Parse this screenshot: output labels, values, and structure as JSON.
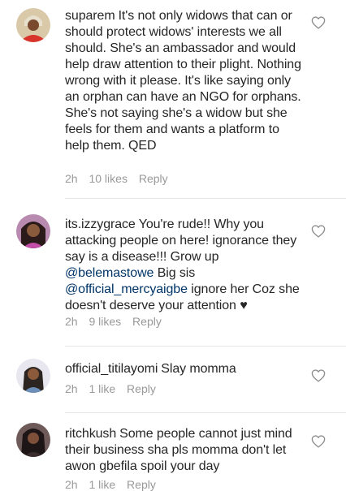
{
  "comments": [
    {
      "username": "suparem",
      "text": "It's not only widows that can or should protect widows' interests we all should. She's an ambassador and would help draw attention to their plight. Nothing wrong with it please. It's like saying only an orphan can have an NGO for orphans. She's not saying she's a widow but she feels for them and wants a platform to help them. QED",
      "time": "2h",
      "likes": "10 likes",
      "reply": "Reply"
    },
    {
      "username": "its.izzygrace",
      "text_1": "You're rude!! Why you attacking people on here! ignorance they say is a disease!!! Grow up",
      "mention_1": "@belemastowe",
      "text_2": "Big sis",
      "mention_2": "@official_mercyaigbe",
      "text_3": "ignore her Coz she doesn't deserve your attention ♥",
      "time": "2h",
      "likes": "9 likes",
      "reply": "Reply"
    },
    {
      "username": "official_titilayomi",
      "text": "Slay momma",
      "time": "2h",
      "likes": "1 like",
      "reply": "Reply"
    },
    {
      "username": "ritchkush",
      "text": "Some people cannot just mind their business sha pls momma don't let awon gbefila spoil your day",
      "time": "2h",
      "likes": "1 like",
      "reply": "Reply"
    }
  ]
}
